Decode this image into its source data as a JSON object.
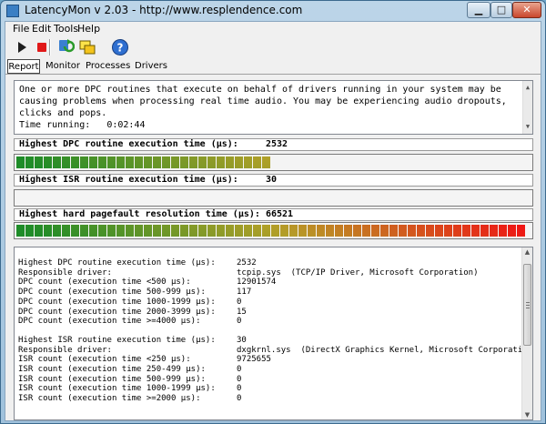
{
  "window": {
    "title": "LatencyMon v 2.03 - http://www.resplendence.com"
  },
  "menu": [
    "File",
    "Edit",
    "Tools",
    "Help"
  ],
  "toolbar": {
    "icons": [
      "play-icon",
      "stop-icon",
      "refresh-icon",
      "windows-icon",
      "help-icon"
    ]
  },
  "tabs": [
    "Report",
    "Monitor",
    "Processes",
    "Drivers"
  ],
  "message": {
    "lines": [
      "One or more DPC routines that execute on behalf of drivers running in your system may be",
      "causing problems when processing real time audio. You may be experiencing audio dropouts,",
      "clicks and pops."
    ],
    "time_label": "Time running:",
    "time_value": "0:02:44"
  },
  "metrics": {
    "dpc": {
      "label": "Highest DPC routine execution time (µs):",
      "value": "2532",
      "fill_segments": 28
    },
    "isr": {
      "label": "Highest ISR routine execution time (µs):",
      "value": "30",
      "fill_segments": 0
    },
    "pagefault": {
      "label": "Highest hard pagefault resolution time (µs):",
      "value": "66521",
      "fill_segments": 56
    }
  },
  "details": {
    "dpc_section": [
      {
        "label": "Highest DPC routine execution time (µs):",
        "value": "2532"
      },
      {
        "label": "Responsible driver:",
        "value": "tcpip.sys  (TCP/IP Driver, Microsoft Corporation)"
      },
      {
        "label": "DPC count (execution time <500 µs):",
        "value": "12901574"
      },
      {
        "label": "DPC count (execution time 500-999 µs):",
        "value": "117"
      },
      {
        "label": "DPC count (execution time 1000-1999 µs):",
        "value": "0"
      },
      {
        "label": "DPC count (execution time 2000-3999 µs):",
        "value": "15"
      },
      {
        "label": "DPC count (execution time >=4000 µs):",
        "value": "0"
      }
    ],
    "isr_section": [
      {
        "label": "Highest ISR routine execution time (µs):",
        "value": "30"
      },
      {
        "label": "Responsible driver:",
        "value": "dxgkrnl.sys  (DirectX Graphics Kernel, Microsoft Corporation)"
      },
      {
        "label": "ISR count (execution time <250 µs):",
        "value": "9725655"
      },
      {
        "label": "ISR count (execution time 250-499 µs):",
        "value": "0"
      },
      {
        "label": "ISR count (execution time 500-999 µs):",
        "value": "0"
      },
      {
        "label": "ISR count (execution time 1000-1999 µs):",
        "value": "0"
      },
      {
        "label": "ISR count (execution time >=2000 µs):",
        "value": "0"
      }
    ]
  }
}
